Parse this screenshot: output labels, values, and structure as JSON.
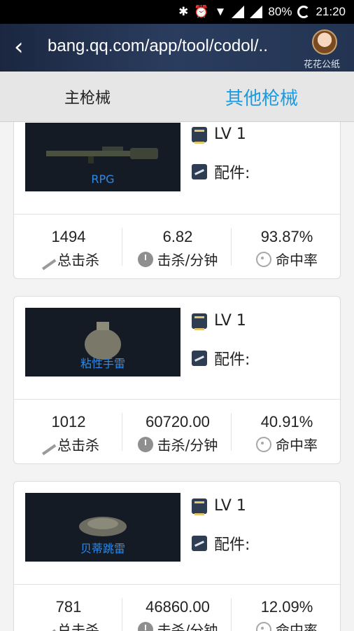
{
  "statusbar": {
    "battery": "80%",
    "time": "21:20"
  },
  "header": {
    "url": "bang.qq.com/app/tool/codol/..",
    "avatar_label": "花花公纸"
  },
  "tabs": [
    {
      "label": "主枪械"
    },
    {
      "label": "其他枪械"
    }
  ],
  "cards": [
    {
      "name": "RPG",
      "level": "LV 1",
      "parts_label": "配件:",
      "stats": [
        {
          "value": "1494",
          "label": "总击杀"
        },
        {
          "value": "6.82",
          "label": "击杀/分钟"
        },
        {
          "value": "93.87%",
          "label": "命中率"
        }
      ]
    },
    {
      "name": "粘性手雷",
      "level": "LV 1",
      "parts_label": "配件:",
      "stats": [
        {
          "value": "1012",
          "label": "总击杀"
        },
        {
          "value": "60720.00",
          "label": "击杀/分钟"
        },
        {
          "value": "40.91%",
          "label": "命中率"
        }
      ]
    },
    {
      "name": "贝蒂跳雷",
      "level": "LV 1",
      "parts_label": "配件:",
      "stats": [
        {
          "value": "781",
          "label": "总击杀"
        },
        {
          "value": "46860.00",
          "label": "击杀/分钟"
        },
        {
          "value": "12.09%",
          "label": "命中率"
        }
      ]
    }
  ]
}
